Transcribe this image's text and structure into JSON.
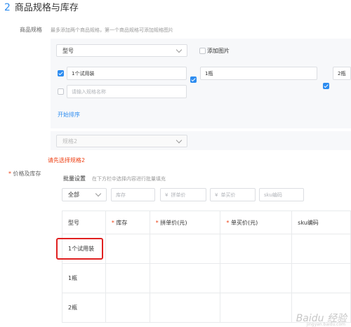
{
  "section": {
    "number": "2",
    "title": "商品规格与库存"
  },
  "spec": {
    "label": "商品规格",
    "hint": "最多添加两个商品规格，第一个商品规格可添加规格图片",
    "spec1_select": "型号",
    "add_image_label": "添加图片",
    "values": [
      "1个试用装",
      "1瓶",
      "2瓶"
    ],
    "new_value_placeholder": "请输入规格名称",
    "sort_link": "开始排序",
    "spec2_select": "规格2",
    "error": "请先选择规格2"
  },
  "stock": {
    "label": "价格及库存",
    "batch_label": "批量设置",
    "batch_hint": "在下方栏中选择内容进行批量填充",
    "filter_select": "全部",
    "placeholders": {
      "stock": "库存",
      "group_price": "拼单价",
      "single_price": "单买价",
      "sku": "sku编码"
    },
    "currency": "¥"
  },
  "table": {
    "headers": [
      "型号",
      "库存",
      "拼单价(元)",
      "单买价(元)",
      "sku编码"
    ],
    "required": [
      false,
      true,
      true,
      true,
      false
    ],
    "rows": [
      [
        "1个试用装"
      ],
      [
        "1瓶"
      ],
      [
        "2瓶"
      ]
    ]
  },
  "watermark": {
    "main": "Baidu 经验",
    "sub": "jingyan.baidu.com"
  },
  "colors": {
    "accent": "#2d8cf0",
    "error": "#ed4014",
    "highlight": "#e02020"
  }
}
